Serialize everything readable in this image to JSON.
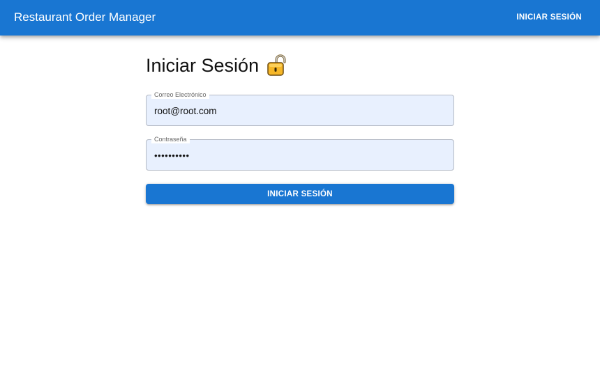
{
  "appbar": {
    "title": "Restaurant Order Manager",
    "login_button": "INICIAR SESIÓN",
    "color": "#1976d2"
  },
  "form": {
    "heading": "Iniciar Sesión",
    "heading_icon": "lock-icon",
    "email": {
      "label": "Correo Electrónico",
      "value": "root@root.com"
    },
    "password": {
      "label": "Contraseña",
      "value": "••••••••••"
    },
    "submit_label": "INICIAR SESIÓN"
  }
}
